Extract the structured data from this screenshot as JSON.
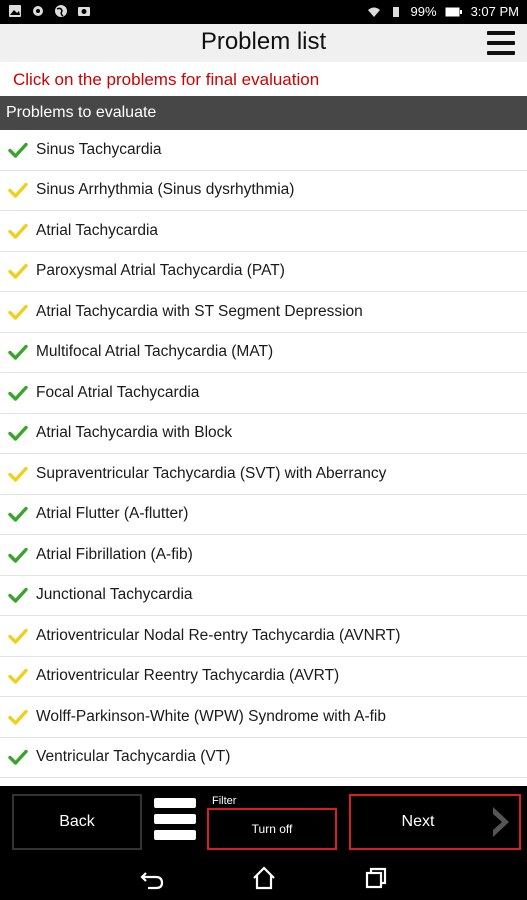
{
  "status_bar": {
    "battery": "99%",
    "time": "3:07 PM"
  },
  "header": {
    "title": "Problem list"
  },
  "instruction": "Click on the problems for final evaluation",
  "section_title": "Problems to evaluate",
  "colors": {
    "check_green": "#3aa52b",
    "check_yellow": "#f2cf1a",
    "instruction_red": "#d00000",
    "button_border_red": "#d42020",
    "section_header_bg": "#474747"
  },
  "problems": [
    {
      "label": "Sinus Tachycardia",
      "status": "green"
    },
    {
      "label": "Sinus Arrhythmia (Sinus dysrhythmia)",
      "status": "yellow"
    },
    {
      "label": "Atrial Tachycardia",
      "status": "yellow"
    },
    {
      "label": "Paroxysmal Atrial Tachycardia (PAT)",
      "status": "yellow"
    },
    {
      "label": "Atrial Tachycardia with ST Segment Depression",
      "status": "yellow"
    },
    {
      "label": "Multifocal Atrial Tachycardia (MAT)",
      "status": "green"
    },
    {
      "label": "Focal Atrial Tachycardia",
      "status": "green"
    },
    {
      "label": "Atrial Tachycardia with Block",
      "status": "green"
    },
    {
      "label": "Supraventricular Tachycardia (SVT) with Aberrancy",
      "status": "yellow"
    },
    {
      "label": "Atrial Flutter (A-flutter)",
      "status": "green"
    },
    {
      "label": "Atrial Fibrillation (A-fib)",
      "status": "green"
    },
    {
      "label": "Junctional Tachycardia",
      "status": "green"
    },
    {
      "label": "Atrioventricular Nodal Re-entry Tachycardia (AVNRT)",
      "status": "yellow"
    },
    {
      "label": "Atrioventricular Reentry Tachycardia (AVRT)",
      "status": "yellow"
    },
    {
      "label": "Wolff-Parkinson-White (WPW) Syndrome with A-fib",
      "status": "yellow"
    },
    {
      "label": "Ventricular Tachycardia (VT)",
      "status": "green"
    }
  ],
  "bottom_bar": {
    "back_label": "Back",
    "filter_label": "Filter",
    "filter_button": "Turn off",
    "next_label": "Next"
  },
  "icons": {
    "menu": "hamburger-menu-icon",
    "list": "list-icon",
    "next_arrow": "chevron-right-icon",
    "nav_back": "back-arrow-icon",
    "nav_home": "home-icon",
    "nav_recent": "recent-apps-icon"
  }
}
